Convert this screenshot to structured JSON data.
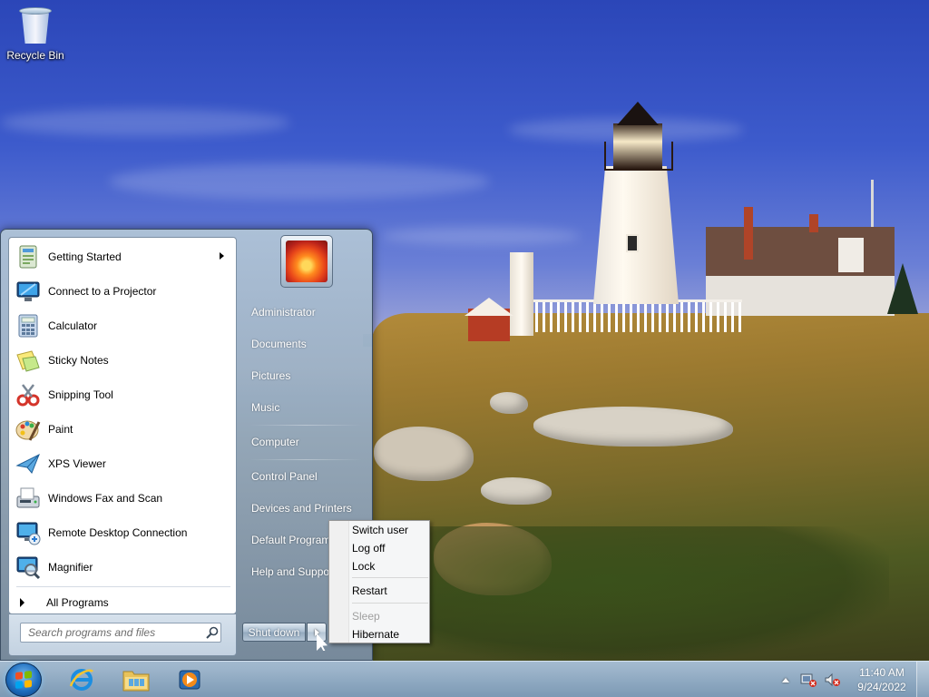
{
  "desktop": {
    "recycle_bin_label": "Recycle Bin"
  },
  "start_menu": {
    "programs": [
      {
        "label": "Getting Started",
        "icon": "getting-started-icon",
        "has_submenu": true
      },
      {
        "label": "Connect to a Projector",
        "icon": "projector-icon"
      },
      {
        "label": "Calculator",
        "icon": "calculator-icon"
      },
      {
        "label": "Sticky Notes",
        "icon": "sticky-notes-icon"
      },
      {
        "label": "Snipping Tool",
        "icon": "snipping-tool-icon"
      },
      {
        "label": "Paint",
        "icon": "paint-icon"
      },
      {
        "label": "XPS Viewer",
        "icon": "xps-viewer-icon"
      },
      {
        "label": "Windows Fax and Scan",
        "icon": "fax-scan-icon"
      },
      {
        "label": "Remote Desktop Connection",
        "icon": "remote-desktop-icon"
      },
      {
        "label": "Magnifier",
        "icon": "magnifier-icon"
      }
    ],
    "all_programs_label": "All Programs",
    "search_placeholder": "Search programs and files",
    "right_links": [
      "Administrator",
      "Documents",
      "Pictures",
      "Music",
      "Computer",
      "Control Panel",
      "Devices and Printers",
      "Default Programs",
      "Help and Support"
    ],
    "shutdown_label": "Shut down"
  },
  "shutdown_flyout": {
    "items": [
      {
        "label": "Switch user",
        "enabled": true
      },
      {
        "label": "Log off",
        "enabled": true
      },
      {
        "label": "Lock",
        "enabled": true
      },
      {
        "label": "Restart",
        "enabled": true
      },
      {
        "label": "Sleep",
        "enabled": false
      },
      {
        "label": "Hibernate",
        "enabled": true
      }
    ]
  },
  "taskbar": {
    "pinned": [
      "internet-explorer-icon",
      "windows-explorer-icon",
      "media-player-icon"
    ],
    "tray_icons": [
      "action-center-icon",
      "volume-muted-icon"
    ],
    "clock_time": "11:40 AM",
    "clock_date": "9/24/2022"
  },
  "colors": {
    "taskbar": "#8aa6c2",
    "start_menu_right_pane": "#8c9fb3",
    "flyout_bg": "#f5f6f7",
    "disabled_text": "#a0a0a0"
  }
}
